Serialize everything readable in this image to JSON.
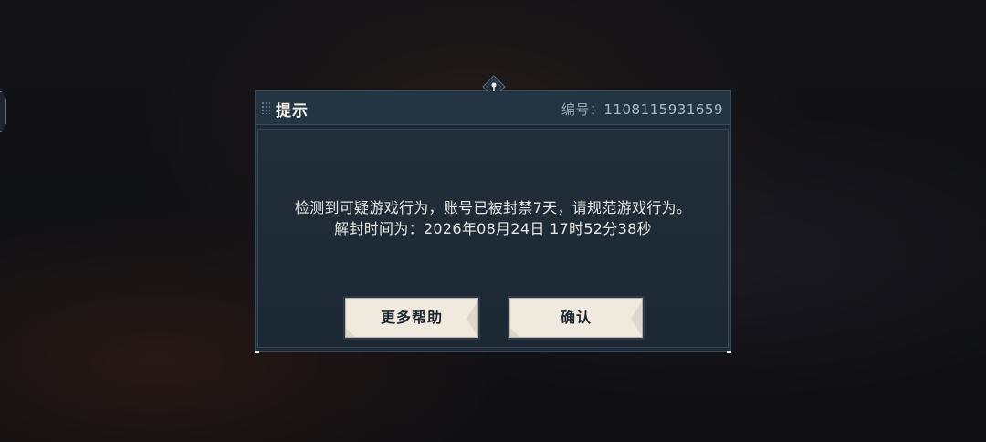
{
  "dialog": {
    "title": "提示",
    "id_label": "编号：",
    "id_value": "1108115931659",
    "message_line1": "检测到可疑游戏行为，账号已被封禁7天，请规范游戏行为。",
    "message_line2": "解封时间为：2026年08月24日 17时52分38秒",
    "help_button": "更多帮助",
    "confirm_button": "确认"
  },
  "icons": {
    "emblem": "diamond-emblem-icon",
    "grip": "drag-grip-icon",
    "side": "side-tab-icon"
  },
  "colors": {
    "dialog_bg": "#1d2a36",
    "header_bg": "#233443",
    "button_bg": "#efe9de",
    "text_light": "#e6e7e2"
  }
}
